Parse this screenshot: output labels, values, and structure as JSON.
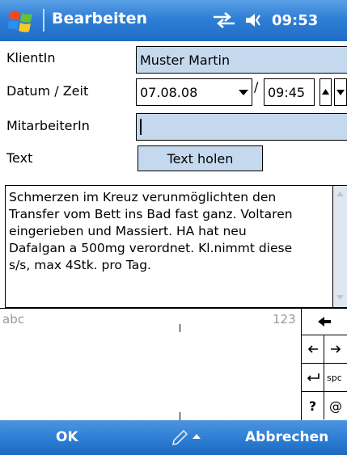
{
  "titlebar": {
    "title": "Bearbeiten",
    "time": "09:53"
  },
  "form": {
    "klient_label": "KlientIn",
    "klient_value": "Muster Martin",
    "datum_label": "Datum / Zeit",
    "date_value": "07.08.08",
    "slash": "/",
    "time_value": "09:45",
    "mitarbeiter_label": "MitarbeiterIn",
    "mitarbeiter_value": "",
    "text_label": "Text",
    "text_button": "Text holen",
    "notes": "Schmerzen im Kreuz verunmöglichten den\nTransfer vom Bett ins Bad fast ganz. Voltaren\neingerieben und Massiert. HA hat neu\nDafalgan a 500mg verordnet. Kl.nimmt diese\ns/s, max 4Stk. pro Tag."
  },
  "input_panel": {
    "left_mode": "abc",
    "right_mode": "123",
    "space_key": "spc",
    "help_key": "?",
    "at_key": "@"
  },
  "softkeys": {
    "left": "OK",
    "right": "Abbrechen"
  },
  "colors": {
    "titlebar": "#2f7fd6",
    "field_fill": "#c5d9ee",
    "scrollbar": "#dfe7f0"
  },
  "icons": [
    "windows-start-icon",
    "connectivity-icon",
    "speaker-icon",
    "dropdown-arrow-icon",
    "spin-up-icon",
    "spin-down-icon",
    "backspace-icon",
    "arrow-left-icon",
    "arrow-right-icon",
    "enter-icon",
    "pen-input-icon"
  ]
}
